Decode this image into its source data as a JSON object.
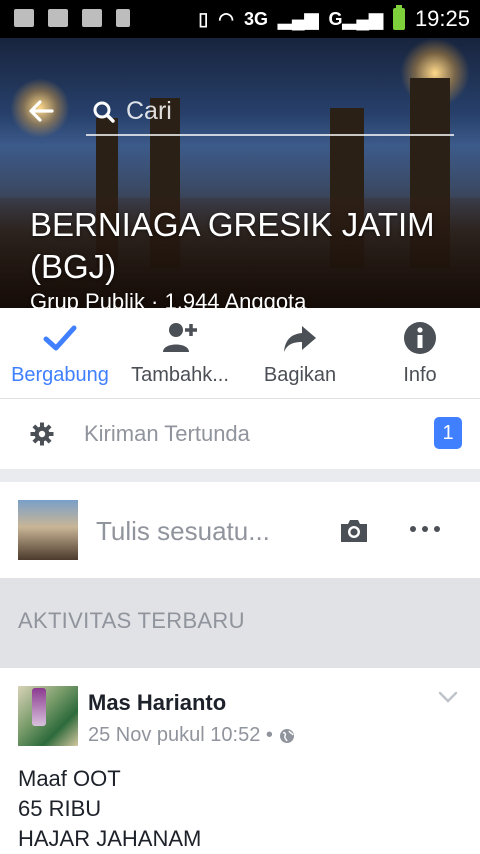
{
  "statusbar": {
    "time": "19:25",
    "network": "3G"
  },
  "search": {
    "placeholder": "Cari"
  },
  "group": {
    "title": "BERNIAGA GRESIK JATIM (BGJ)",
    "subtitle": "Grup Publik · 1.944 Anggota"
  },
  "actions": [
    {
      "label": "Bergabung",
      "icon": "check-icon"
    },
    {
      "label": "Tambahk...",
      "icon": "add-person-icon"
    },
    {
      "label": "Bagikan",
      "icon": "share-icon"
    },
    {
      "label": "Info",
      "icon": "info-icon"
    }
  ],
  "pending": {
    "label": "Kiriman Tertunda",
    "count": "1"
  },
  "composer": {
    "placeholder": "Tulis sesuatu..."
  },
  "section": {
    "title": "AKTIVITAS TERBARU"
  },
  "post": {
    "author": "Mas Harianto",
    "timestamp": "25 Nov pukul 10:52 •",
    "lines": [
      "Maaf OOT",
      "65 RIBU",
      "HAJAR JAHANAM"
    ]
  },
  "colors": {
    "accent": "#4080ff",
    "text": "#1d2129",
    "muted": "#90949c"
  }
}
